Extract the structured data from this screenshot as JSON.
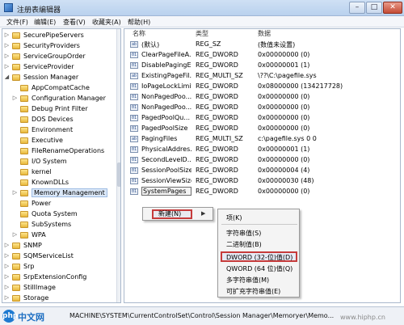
{
  "window": {
    "title": "注册表编辑器",
    "minimize": "–",
    "maximize": "□",
    "close": "✕"
  },
  "menu": [
    "文件(F)",
    "编辑(E)",
    "查看(V)",
    "收藏夹(A)",
    "帮助(H)"
  ],
  "tree": {
    "items": [
      {
        "label": "SecurePipeServers",
        "exp": "▷"
      },
      {
        "label": "SecurityProviders",
        "exp": "▷"
      },
      {
        "label": "ServiceGroupOrder",
        "exp": "▷"
      },
      {
        "label": "ServiceProvider",
        "exp": "▷"
      },
      {
        "label": "Session Manager",
        "exp": "◢"
      },
      {
        "label": "AppCompatCache",
        "exp": ""
      },
      {
        "label": "Configuration Manager",
        "exp": "▷"
      },
      {
        "label": "Debug Print Filter",
        "exp": ""
      },
      {
        "label": "DOS Devices",
        "exp": ""
      },
      {
        "label": "Environment",
        "exp": ""
      },
      {
        "label": "Executive",
        "exp": ""
      },
      {
        "label": "FileRenameOperations",
        "exp": ""
      },
      {
        "label": "I/O System",
        "exp": ""
      },
      {
        "label": "kernel",
        "exp": ""
      },
      {
        "label": "KnownDLLs",
        "exp": ""
      },
      {
        "label": "Memory Management",
        "exp": "▷"
      },
      {
        "label": "Power",
        "exp": ""
      },
      {
        "label": "Quota System",
        "exp": ""
      },
      {
        "label": "SubSystems",
        "exp": ""
      },
      {
        "label": "WPA",
        "exp": "▷"
      },
      {
        "label": "SNMP",
        "exp": "▷"
      },
      {
        "label": "SQMServiceList",
        "exp": "▷"
      },
      {
        "label": "Srp",
        "exp": "▷"
      },
      {
        "label": "SrpExtensionConfig",
        "exp": "▷"
      },
      {
        "label": "StillImage",
        "exp": "▷"
      },
      {
        "label": "Storage",
        "exp": "▷"
      }
    ]
  },
  "values": {
    "columns": [
      "名称",
      "类型",
      "数据"
    ],
    "rows": [
      {
        "icon": "ab",
        "name": "(默认)",
        "type": "REG_SZ",
        "data": "(数值未设置)"
      },
      {
        "icon": "01",
        "name": "ClearPageFileA...",
        "type": "REG_DWORD",
        "data": "0x00000000 (0)"
      },
      {
        "icon": "01",
        "name": "DisablePagingE...",
        "type": "REG_DWORD",
        "data": "0x00000001 (1)"
      },
      {
        "icon": "ab",
        "name": "ExistingPageFil...",
        "type": "REG_MULTI_SZ",
        "data": "\\??\\C:\\pagefile.sys"
      },
      {
        "icon": "01",
        "name": "IoPageLockLimit",
        "type": "REG_DWORD",
        "data": "0x08000000 (134217728)"
      },
      {
        "icon": "01",
        "name": "NonPagedPoo...",
        "type": "REG_DWORD",
        "data": "0x00000000 (0)"
      },
      {
        "icon": "01",
        "name": "NonPagedPoo...",
        "type": "REG_DWORD",
        "data": "0x00000000 (0)"
      },
      {
        "icon": "01",
        "name": "PagedPoolQu...",
        "type": "REG_DWORD",
        "data": "0x00000000 (0)"
      },
      {
        "icon": "01",
        "name": "PagedPoolSize",
        "type": "REG_DWORD",
        "data": "0x00000000 (0)"
      },
      {
        "icon": "ab",
        "name": "PagingFiles",
        "type": "REG_MULTI_SZ",
        "data": "c:\\pagefile.sys 0 0"
      },
      {
        "icon": "01",
        "name": "PhysicalAddres...",
        "type": "REG_DWORD",
        "data": "0x00000001 (1)"
      },
      {
        "icon": "01",
        "name": "SecondLevelD...",
        "type": "REG_DWORD",
        "data": "0x00000000 (0)"
      },
      {
        "icon": "01",
        "name": "SessionPoolSize",
        "type": "REG_DWORD",
        "data": "0x00000004 (4)"
      },
      {
        "icon": "01",
        "name": "SessionViewSize",
        "type": "REG_DWORD",
        "data": "0x00000030 (48)"
      },
      {
        "icon": "01",
        "name": "SystemPages",
        "type": "REG_DWORD",
        "data": "0x00000000 (0)"
      }
    ]
  },
  "context_menu": {
    "new_label": "新建(N)",
    "arrow": "▶"
  },
  "submenu": {
    "items": [
      "项(K)",
      "字符串值(S)",
      "二进制值(B)",
      "DWORD (32-位)值(D)",
      "QWORD (64 位)值(Q)",
      "多字符串值(M)",
      "可扩充字符串值(E)"
    ]
  },
  "status": {
    "path": "MACHINE\\SYSTEM\\CurrentControlSet\\Control\\Session Manager\\Memoryer\\Memo..."
  },
  "watermark": {
    "logo": "php",
    "text": "中文网",
    "site": "www.hiphp.cn"
  }
}
